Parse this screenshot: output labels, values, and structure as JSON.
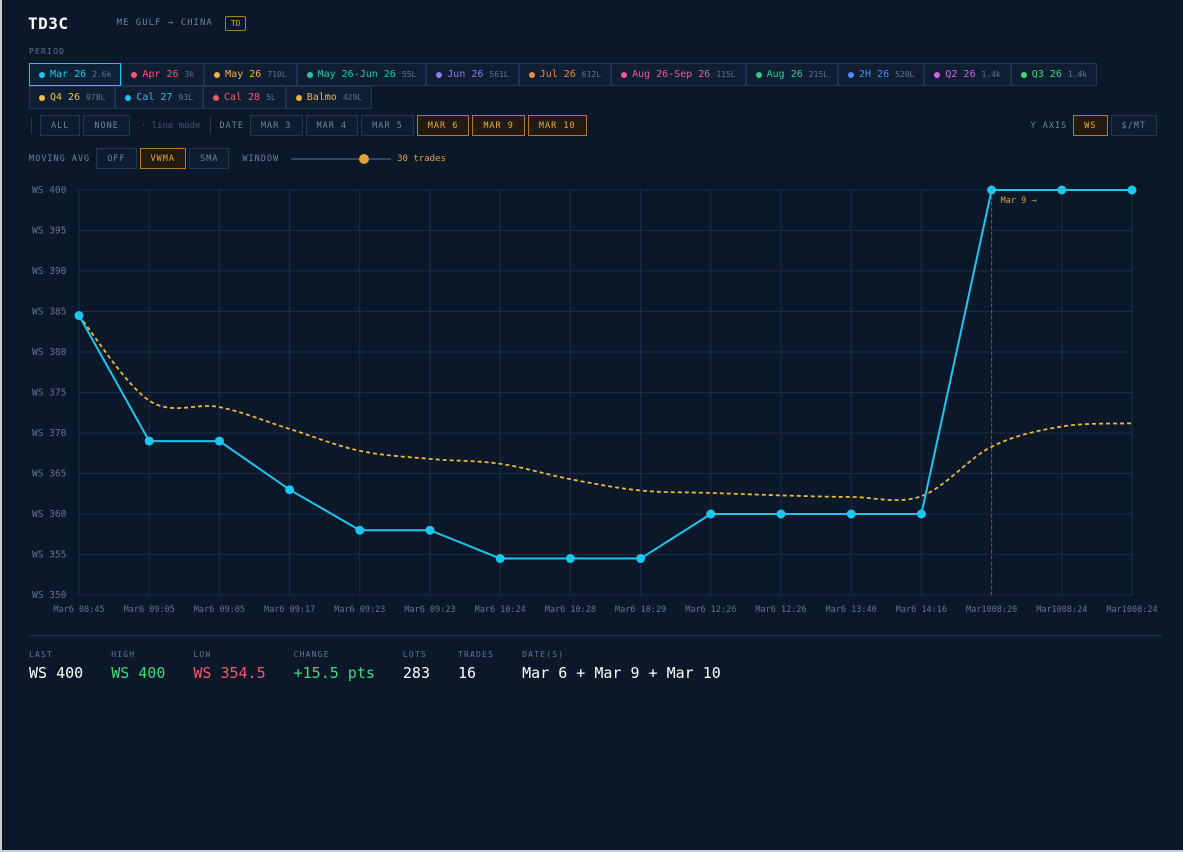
{
  "header": {
    "ticker": "TD3C",
    "route": "ME GULF → CHINA",
    "tag": "TD"
  },
  "period_label": "PERIOD",
  "periods_row1": [
    {
      "label": "Mar 26",
      "lots": "2.6k",
      "color": "#1cc6ee",
      "active": true
    },
    {
      "label": "Apr 26",
      "lots": "3k",
      "color": "#f25c6a"
    },
    {
      "label": "May 26",
      "lots": "710L",
      "color": "#f2b441"
    },
    {
      "label": "May 26-Jun 26",
      "lots": "55L",
      "color": "#1fc9a0"
    },
    {
      "label": "Jun 26",
      "lots": "561L",
      "color": "#8a7cf0"
    },
    {
      "label": "Jul 26",
      "lots": "612L",
      "color": "#f08a3c"
    },
    {
      "label": "Aug 26-Sep 26",
      "lots": "115L",
      "color": "#f25c9b"
    },
    {
      "label": "Aug 26",
      "lots": "215L",
      "color": "#2ecc8f"
    },
    {
      "label": "2H 26",
      "lots": "520L",
      "color": "#4b8ef2"
    },
    {
      "label": "Q2 26",
      "lots": "1.4k",
      "color": "#d466e0"
    },
    {
      "label": "Q3 26",
      "lots": "1.4k",
      "color": "#3ddc7a"
    }
  ],
  "periods_row2": [
    {
      "label": "Q4 26",
      "lots": "978L",
      "color": "#e8c53a"
    },
    {
      "label": "Cal 27",
      "lots": "93L",
      "color": "#1cc6ee"
    },
    {
      "label": "Cal 28",
      "lots": "5L",
      "color": "#f25c6a"
    },
    {
      "label": "Balmo",
      "lots": "429L",
      "color": "#f2b441"
    }
  ],
  "controls": {
    "all": "ALL",
    "none": "NONE",
    "line_mode": "· line mode",
    "date_label": "DATE",
    "dates": [
      {
        "label": "MAR 3",
        "on": false
      },
      {
        "label": "MAR 4",
        "on": false
      },
      {
        "label": "MAR 5",
        "on": false
      },
      {
        "label": "MAR 6",
        "on": true
      },
      {
        "label": "MAR 9",
        "on": true
      },
      {
        "label": "MAR 10",
        "on": true
      }
    ],
    "yaxis_label": "Y AXIS",
    "yaxis_ws": "WS",
    "yaxis_mt": "$/MT",
    "mavg_label": "MOVING AVG",
    "mavg_off": "OFF",
    "mavg_vwma": "VWMA",
    "mavg_sma": "SMA",
    "window_label": "WINDOW",
    "window_value": 30,
    "window_max": 40,
    "window_text": "30 trades"
  },
  "chart_data": {
    "type": "line",
    "x": [
      "Mar6 08:45",
      "Mar6 09:05",
      "Mar6 09:05",
      "Mar6 09:17",
      "Mar6 09:23",
      "Mar6 09:23",
      "Mar6 10:24",
      "Mar6 10:28",
      "Mar6 10:29",
      "Mar6 12:26",
      "Mar6 12:26",
      "Mar6 13:40",
      "Mar6 14:16",
      "Mar1008:20",
      "Mar1008:24",
      "Mar1008:24"
    ],
    "series": [
      {
        "values": [
          384.5,
          369,
          369,
          363,
          358,
          358,
          354.5,
          354.5,
          354.5,
          360,
          360,
          360,
          360,
          400,
          400,
          400
        ],
        "color": "#1cc6ee",
        "style": "solid"
      },
      {
        "values": [
          384.5,
          374,
          373.2,
          370.5,
          367.8,
          366.8,
          366.2,
          364.3,
          362.9,
          362.6,
          362.3,
          362.1,
          362.2,
          368.3,
          370.8,
          371.2
        ],
        "color": "#e8b93a",
        "style": "dashed"
      }
    ],
    "ylim": [
      350,
      400
    ],
    "yticks": [
      "WS 400",
      "WS 395",
      "WS 390",
      "WS 385",
      "WS 380",
      "WS 375",
      "WS 370",
      "WS 365",
      "WS 360",
      "WS 355",
      "WS 350"
    ],
    "ytick_values": [
      400,
      395,
      390,
      385,
      380,
      375,
      370,
      365,
      360,
      355,
      350
    ],
    "annotation": {
      "text": "Mar 9 →",
      "at_index": 13
    },
    "grid": true
  },
  "stats": [
    {
      "label": "LAST",
      "value": "WS 400",
      "color": "#ffffff"
    },
    {
      "label": "HIGH",
      "value": "WS 400",
      "color": "#3ddc7a"
    },
    {
      "label": "LOW",
      "value": "WS 354.5",
      "color": "#f25c6a"
    },
    {
      "label": "CHANGE",
      "value": "+15.5 pts",
      "color": "#3ddc7a"
    },
    {
      "label": "LOTS",
      "value": "283",
      "color": "#ffffff"
    },
    {
      "label": "TRADES",
      "value": "16",
      "color": "#ffffff"
    },
    {
      "label": "DATE(S)",
      "value": "Mar 6 + Mar 9 + Mar 10",
      "color": "#ffffff"
    }
  ]
}
